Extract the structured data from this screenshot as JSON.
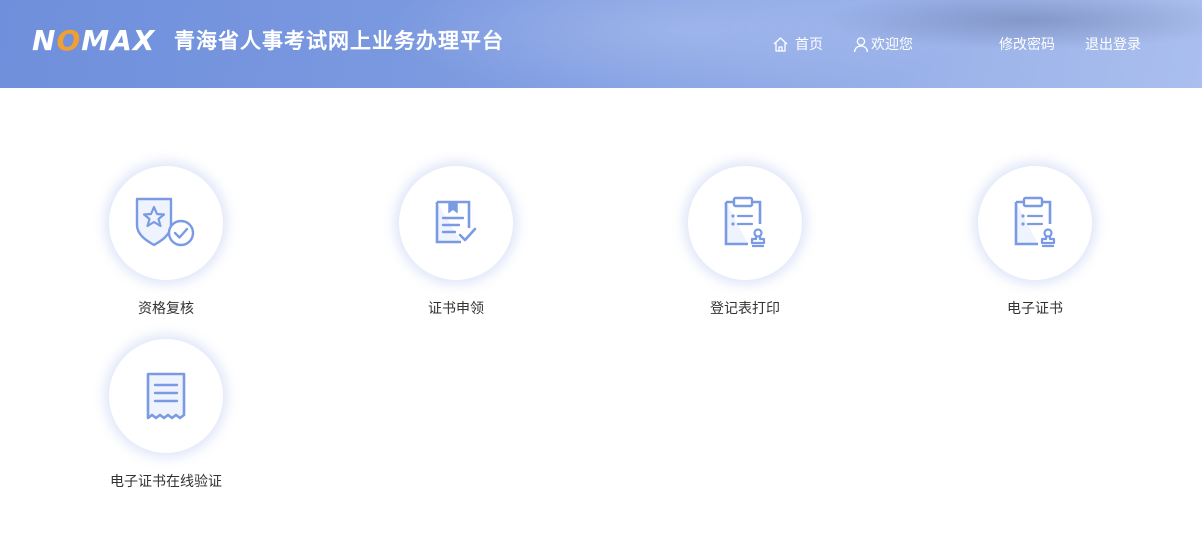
{
  "header": {
    "logo_text_n": "N",
    "logo_text_o": "O",
    "logo_text_rest": "MAX",
    "title": "青海省人事考试网上业务办理平台",
    "nav": {
      "home": "首页",
      "welcome": "欢迎您",
      "change_password": "修改密码",
      "logout": "退出登录"
    },
    "icons": {
      "home": "home-icon",
      "user": "user-icon"
    },
    "colors": {
      "gradient_start": "#6f8fdc",
      "gradient_end": "#aabfee",
      "logo_accent": "#f0a030"
    }
  },
  "tiles": [
    {
      "label": "资格复核",
      "icon": "qualification-review-icon"
    },
    {
      "label": "证书申领",
      "icon": "certificate-apply-icon"
    },
    {
      "label": "登记表打印",
      "icon": "registration-print-icon"
    },
    {
      "label": "电子证书",
      "icon": "e-certificate-icon"
    },
    {
      "label": "电子证书在线验证",
      "icon": "online-verify-icon"
    }
  ],
  "colors": {
    "icon_stroke": "#7a9be3",
    "label_text": "#333333"
  }
}
